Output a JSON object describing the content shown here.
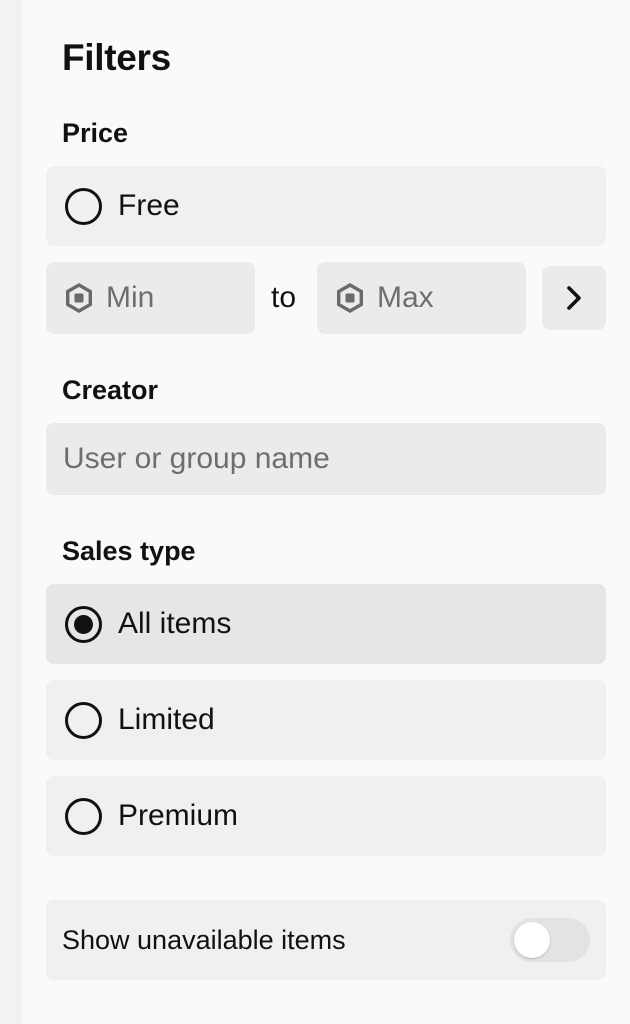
{
  "panel": {
    "title": "Filters"
  },
  "price": {
    "label": "Price",
    "free_option": {
      "label": "Free",
      "selected": false
    },
    "min_placeholder": "Min",
    "to_text": "to",
    "max_placeholder": "Max",
    "currency_icon": "robux-icon",
    "submit_icon": "chevron-right-icon"
  },
  "creator": {
    "label": "Creator",
    "placeholder": "User or group name",
    "value": ""
  },
  "sales_type": {
    "label": "Sales type",
    "options": [
      {
        "label": "All items",
        "selected": true
      },
      {
        "label": "Limited",
        "selected": false
      },
      {
        "label": "Premium",
        "selected": false
      }
    ]
  },
  "unavailable": {
    "label": "Show unavailable items",
    "enabled": false
  },
  "colors": {
    "page_edge": "#f2f2f2",
    "panel_background": "#fafafa",
    "row_background": "#f0f0f0",
    "selected_row_background": "#e6e6e6",
    "input_background": "#ebebeb",
    "text": "#111111",
    "placeholder": "#6e6e6e"
  }
}
